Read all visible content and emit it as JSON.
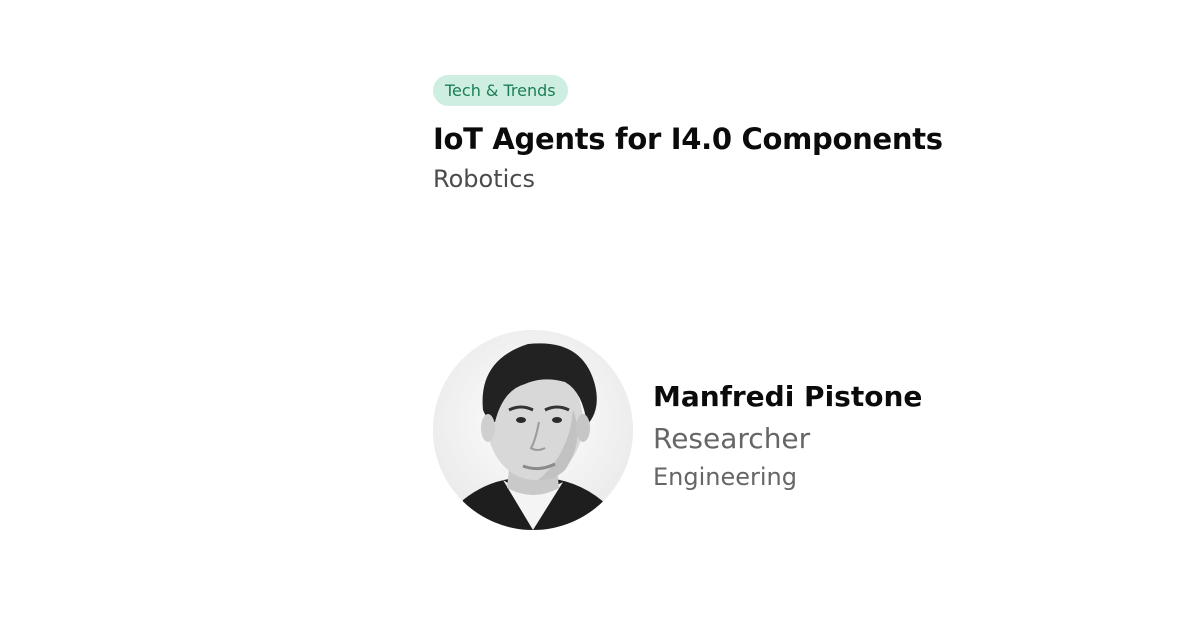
{
  "article": {
    "tag": "Tech & Trends",
    "title": "IoT Agents for I4.0 Components",
    "category": "Robotics"
  },
  "author": {
    "name": "Manfredi Pistone",
    "role": "Researcher",
    "department": "Engineering",
    "avatar_icon": "person-photo"
  },
  "colors": {
    "tag_background": "#cdeee0",
    "tag_text": "#1a7f55",
    "title": "#0b0b0b",
    "secondary_text": "#666666"
  }
}
